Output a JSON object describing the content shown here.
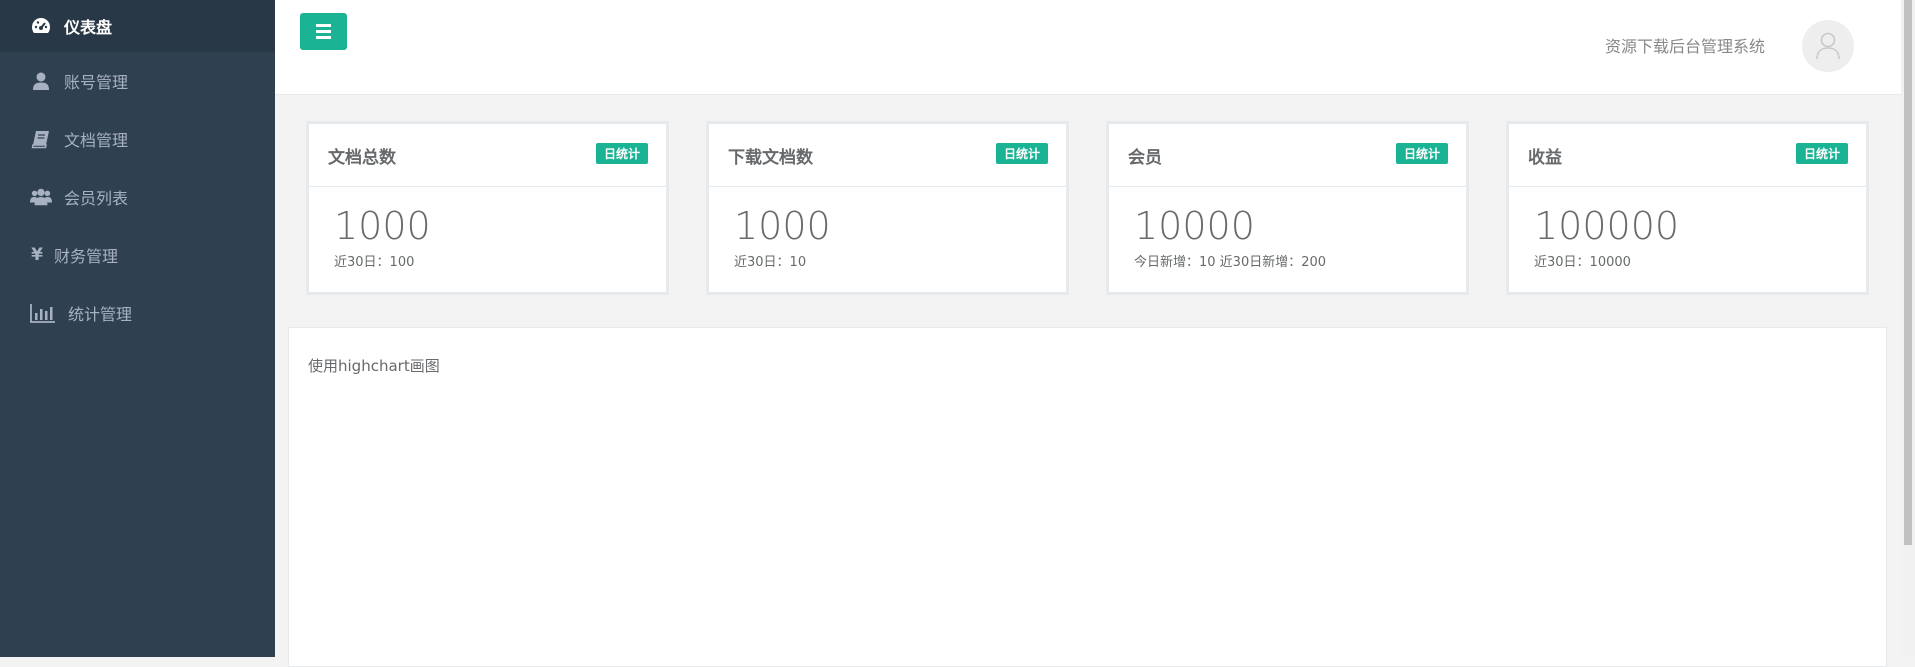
{
  "sidebar": {
    "items": [
      {
        "label": "仪表盘",
        "icon": "dashboard-icon",
        "active": true
      },
      {
        "label": "账号管理",
        "icon": "user-icon"
      },
      {
        "label": "文档管理",
        "icon": "book-icon"
      },
      {
        "label": "会员列表",
        "icon": "users-icon"
      },
      {
        "label": "财务管理",
        "icon": "yen-icon"
      },
      {
        "label": "统计管理",
        "icon": "bar-chart-icon"
      }
    ]
  },
  "header": {
    "menu_icon": "menu-icon",
    "system_title": "资源下载后台管理系统",
    "avatar_icon": "avatar-icon"
  },
  "stats": [
    {
      "title": "文档总数",
      "badge": "日统计",
      "value": "1000",
      "sub": "近30日：100"
    },
    {
      "title": "下载文档数",
      "badge": "日统计",
      "value": "1000",
      "sub": "近30日：10"
    },
    {
      "title": "会员",
      "badge": "日统计",
      "value": "10000",
      "sub": "今日新增：10 近30日新增：200"
    },
    {
      "title": "收益",
      "badge": "日统计",
      "value": "100000",
      "sub": "近30日：10000"
    }
  ],
  "chart_panel": {
    "note": "使用highchart画图"
  },
  "colors": {
    "sidebar_bg": "#2f4050",
    "sidebar_active_bg": "#293846",
    "accent": "#1ab394"
  }
}
